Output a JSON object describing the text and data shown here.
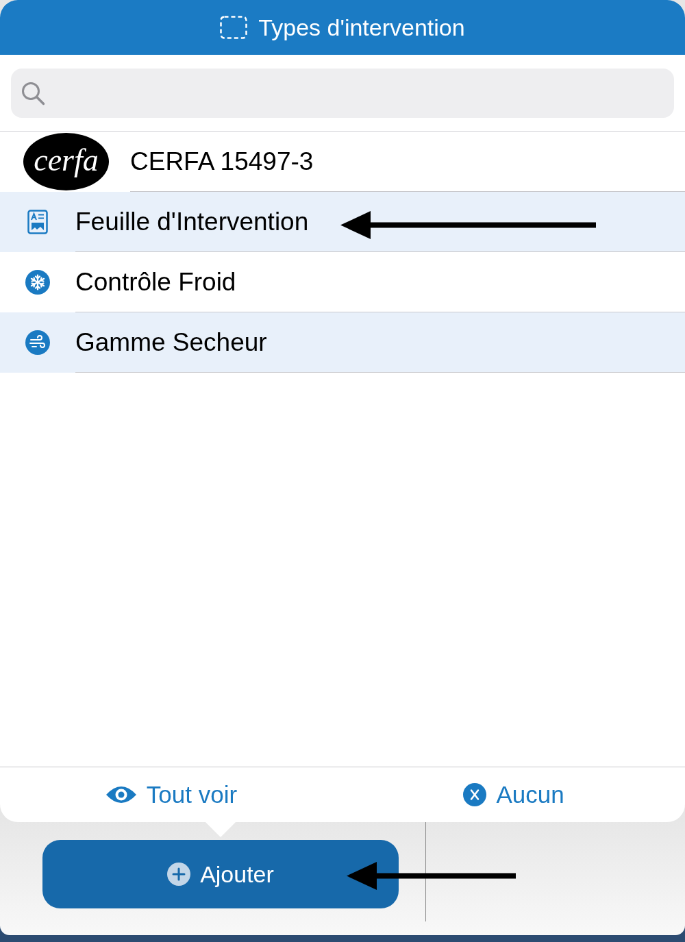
{
  "header": {
    "title": "Types d'intervention"
  },
  "items": [
    {
      "kind": "logo",
      "logo": "cerfa",
      "label": "CERFA 15497-3",
      "selected": false
    },
    {
      "kind": "icon",
      "label": "Feuille d'Intervention",
      "selected": true
    },
    {
      "kind": "icon",
      "label": "Contrôle Froid",
      "selected": false
    },
    {
      "kind": "icon",
      "label": "Gamme Secheur",
      "selected": true
    }
  ],
  "footer_actions": [
    {
      "label": "Tout voir"
    },
    {
      "label": "Aucun"
    }
  ],
  "add_button": {
    "label": "Ajouter"
  }
}
